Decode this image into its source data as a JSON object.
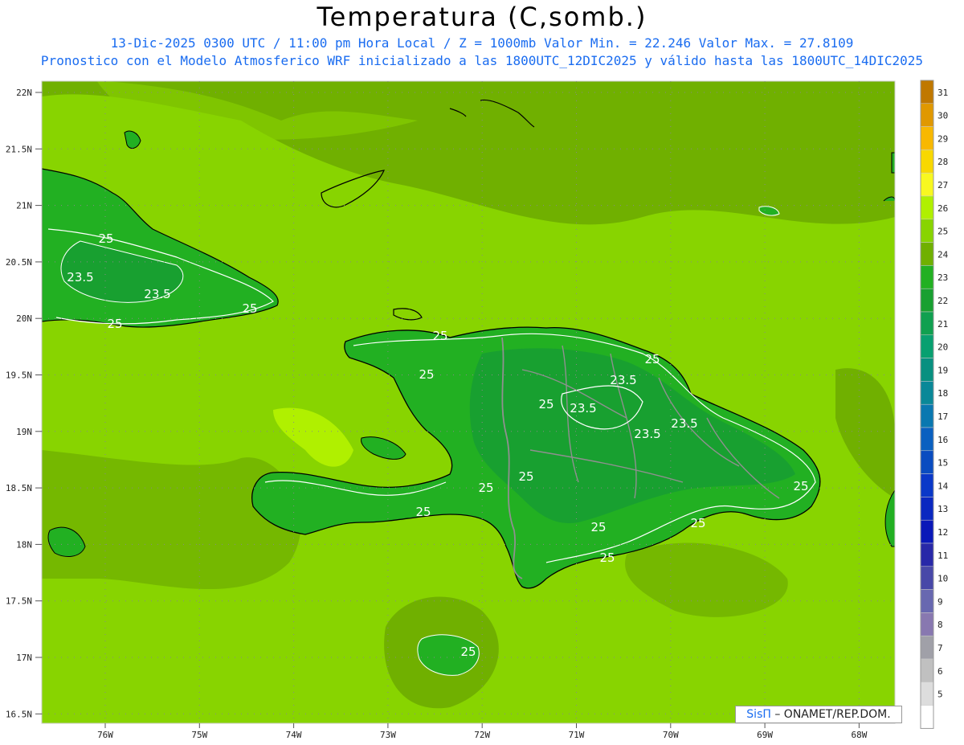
{
  "title": "Temperatura (C,somb.)",
  "subtitle_line1": "13-Dic-2025 0300 UTC / 11:00 pm Hora Local / Z = 1000mb   Valor Min. = 22.246  Valor Max. = 27.8109",
  "subtitle_line2": "Pronostico con el Modelo Atmosferico WRF inicializado a las 1800UTC_12DIC2025 y válido hasta las  1800UTC_14DIC2025",
  "lat_labels": [
    "22N",
    "21.5N",
    "21N",
    "20.5N",
    "20N",
    "19.5N",
    "19N",
    "18.5N",
    "18N",
    "17.5N",
    "17N",
    "16.5N"
  ],
  "lon_labels": [
    "76W",
    "75W",
    "74W",
    "73W",
    "72W",
    "71W",
    "70W",
    "69W",
    "68W"
  ],
  "contour_labels": [
    "25",
    "23.5",
    "23.5",
    "25",
    "25",
    "25",
    "25",
    "25",
    "23.5",
    "25",
    "23.5",
    "23.5",
    "23.5",
    "25",
    "25",
    "25",
    "25",
    "25",
    "25",
    "25",
    "25"
  ],
  "colorbar": {
    "labels": [
      "31",
      "30",
      "29",
      "28",
      "27",
      "26",
      "25",
      "24",
      "23",
      "22",
      "21",
      "20",
      "19",
      "18",
      "17",
      "16",
      "15",
      "14",
      "13",
      "12",
      "11",
      "10",
      "9",
      "8",
      "7",
      "6",
      "5"
    ],
    "colors": [
      "#c07800",
      "#e09800",
      "#f8b800",
      "#f8d800",
      "#f8f820",
      "#b0f000",
      "#88d400",
      "#70b000",
      "#22b022",
      "#18a030",
      "#10a050",
      "#08a070",
      "#089080",
      "#0a8898",
      "#0a78b0",
      "#0a60c0",
      "#0a4cc0",
      "#0a38c8",
      "#0a28c0",
      "#0a18b8",
      "#2828a8",
      "#4848a8",
      "#6868b0",
      "#8878b0",
      "#a0a0a8",
      "#c0c0c0",
      "#dddddd",
      "#ffffff"
    ]
  },
  "colors": {
    "sea_base": "#88d400",
    "sea_light": "#b0f000",
    "land_green": "#22b022",
    "land_darker": "#18a030",
    "mid_green": "#70b000",
    "coast": "#000000",
    "border": "#909090",
    "contour": "#ffffff"
  },
  "brand": {
    "part1": "SisΠ",
    "part2": "– ONAMET/REP.DOM."
  }
}
